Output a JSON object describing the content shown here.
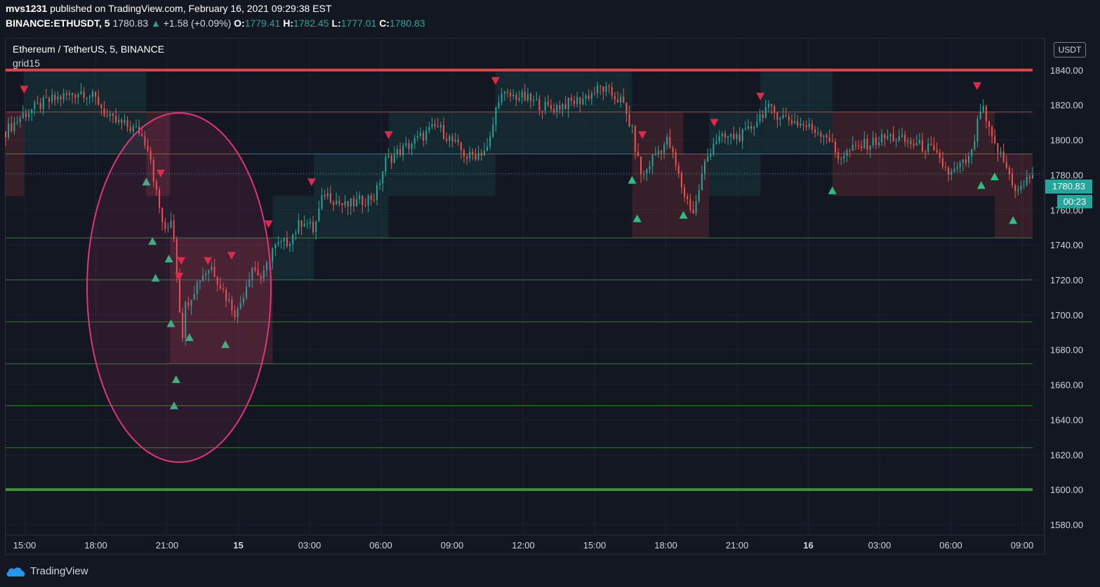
{
  "header": {
    "user": "mvs1231",
    "published_text": "published on TradingView.com, February 16, 2021 09:29:38 EST",
    "symbol": "BINANCE:ETHUSDT, 5",
    "last": "1780.83",
    "change": "+1.58 (+0.09%)",
    "o_label": "O:",
    "o": "1779.41",
    "h_label": "H:",
    "h": "1782.45",
    "l_label": "L:",
    "l": "1777.01",
    "c_label": "C:",
    "c": "1780.83"
  },
  "legend": {
    "series_title": "Ethereum / TetherUS, 5, BINANCE",
    "indicator": "grid15"
  },
  "currency": "USDT",
  "price_tag": "1780.83",
  "countdown": "00:23",
  "brand": "TradingView",
  "colors": {
    "background": "#131722",
    "up": "#26a69a",
    "down": "#ef5350",
    "buy_marker": "#2ebd85",
    "sell_marker": "#e0294a",
    "resistance_line": "#e0434b",
    "support_line": "#3f8f3f",
    "circle": "#e0357a"
  },
  "chart_data": {
    "type": "candlestick",
    "title": "Ethereum / TetherUS, 5, BINANCE",
    "y_ticks": [
      "1840.00",
      "1820.00",
      "1800.00",
      "1780.00",
      "1760.00",
      "1740.00",
      "1720.00",
      "1700.00",
      "1680.00",
      "1660.00",
      "1640.00",
      "1620.00",
      "1600.00",
      "1580.00"
    ],
    "ylim": [
      1574,
      1858
    ],
    "x_ticks": [
      "15:00",
      "18:00",
      "21:00",
      "15",
      "03:00",
      "06:00",
      "09:00",
      "12:00",
      "15:00",
      "18:00",
      "21:00",
      "16",
      "03:00",
      "06:00",
      "09:00"
    ],
    "grid_levels": [
      {
        "price": 1840,
        "kind": "resistance",
        "bold": true
      },
      {
        "price": 1816,
        "kind": "resistance"
      },
      {
        "price": 1792,
        "kind": "resistance"
      },
      {
        "price": 1744,
        "kind": "support"
      },
      {
        "price": 1720,
        "kind": "support"
      },
      {
        "price": 1696,
        "kind": "support"
      },
      {
        "price": 1672,
        "kind": "support"
      },
      {
        "price": 1648,
        "kind": "support"
      },
      {
        "price": 1624,
        "kind": "support"
      },
      {
        "price": 1600,
        "kind": "support",
        "bold": true
      }
    ],
    "last_price": 1780.83,
    "price_path": [
      [
        0,
        1805
      ],
      [
        0.018,
        1815
      ],
      [
        0.04,
        1822
      ],
      [
        0.075,
        1828
      ],
      [
        0.09,
        1822
      ],
      [
        0.1,
        1812
      ],
      [
        0.13,
        1805
      ],
      [
        0.14,
        1795
      ],
      [
        0.145,
        1775
      ],
      [
        0.15,
        1760
      ],
      [
        0.156,
        1745
      ],
      [
        0.162,
        1758
      ],
      [
        0.17,
        1700
      ],
      [
        0.165,
        1680
      ],
      [
        0.168,
        1665
      ],
      [
        0.175,
        1705
      ],
      [
        0.19,
        1722
      ],
      [
        0.2,
        1728
      ],
      [
        0.215,
        1710
      ],
      [
        0.225,
        1700
      ],
      [
        0.24,
        1728
      ],
      [
        0.25,
        1720
      ],
      [
        0.26,
        1738
      ],
      [
        0.275,
        1742
      ],
      [
        0.29,
        1755
      ],
      [
        0.3,
        1748
      ],
      [
        0.31,
        1770
      ],
      [
        0.33,
        1762
      ],
      [
        0.36,
        1768
      ],
      [
        0.37,
        1788
      ],
      [
        0.4,
        1800
      ],
      [
        0.42,
        1808
      ],
      [
        0.45,
        1790
      ],
      [
        0.47,
        1795
      ],
      [
        0.48,
        1825
      ],
      [
        0.5,
        1825
      ],
      [
        0.53,
        1818
      ],
      [
        0.56,
        1823
      ],
      [
        0.58,
        1830
      ],
      [
        0.6,
        1822
      ],
      [
        0.61,
        1805
      ],
      [
        0.615,
        1790
      ],
      [
        0.62,
        1778
      ],
      [
        0.63,
        1790
      ],
      [
        0.645,
        1800
      ],
      [
        0.66,
        1770
      ],
      [
        0.67,
        1758
      ],
      [
        0.68,
        1785
      ],
      [
        0.69,
        1800
      ],
      [
        0.72,
        1803
      ],
      [
        0.74,
        1818
      ],
      [
        0.77,
        1810
      ],
      [
        0.8,
        1803
      ],
      [
        0.81,
        1790
      ],
      [
        0.83,
        1796
      ],
      [
        0.86,
        1802
      ],
      [
        0.9,
        1795
      ],
      [
        0.92,
        1780
      ],
      [
        0.94,
        1790
      ],
      [
        0.95,
        1820
      ],
      [
        0.96,
        1800
      ],
      [
        0.97,
        1790
      ],
      [
        0.985,
        1770
      ],
      [
        1.0,
        1781
      ]
    ],
    "buy_signals": [
      {
        "t": 0.137,
        "p": 1776
      },
      {
        "t": 0.143,
        "p": 1742
      },
      {
        "t": 0.146,
        "p": 1721
      },
      {
        "t": 0.159,
        "p": 1732
      },
      {
        "t": 0.161,
        "p": 1695
      },
      {
        "t": 0.166,
        "p": 1663
      },
      {
        "t": 0.164,
        "p": 1648
      },
      {
        "t": 0.179,
        "p": 1687
      },
      {
        "t": 0.214,
        "p": 1683
      },
      {
        "t": 0.61,
        "p": 1777
      },
      {
        "t": 0.615,
        "p": 1755
      },
      {
        "t": 0.66,
        "p": 1757
      },
      {
        "t": 0.805,
        "p": 1771
      },
      {
        "t": 0.95,
        "p": 1774
      },
      {
        "t": 0.963,
        "p": 1779
      },
      {
        "t": 0.981,
        "p": 1754
      }
    ],
    "sell_signals": [
      {
        "t": 0.018,
        "p": 1829
      },
      {
        "t": 0.151,
        "p": 1781
      },
      {
        "t": 0.171,
        "p": 1731
      },
      {
        "t": 0.169,
        "p": 1722
      },
      {
        "t": 0.197,
        "p": 1731
      },
      {
        "t": 0.22,
        "p": 1734
      },
      {
        "t": 0.256,
        "p": 1752
      },
      {
        "t": 0.298,
        "p": 1776
      },
      {
        "t": 0.373,
        "p": 1803
      },
      {
        "t": 0.477,
        "p": 1834
      },
      {
        "t": 0.62,
        "p": 1803
      },
      {
        "t": 0.69,
        "p": 1810
      },
      {
        "t": 0.735,
        "p": 1825
      },
      {
        "t": 0.946,
        "p": 1831
      }
    ],
    "zones": [
      {
        "t0": 0.0,
        "t1": 0.018,
        "top": 1816,
        "bot": 1768,
        "kind": "down"
      },
      {
        "t0": 0.018,
        "t1": 0.137,
        "top": 1840,
        "bot": 1792,
        "kind": "up"
      },
      {
        "t0": 0.137,
        "t1": 0.16,
        "top": 1816,
        "bot": 1768,
        "kind": "down"
      },
      {
        "t0": 0.16,
        "t1": 0.2,
        "top": 1744,
        "bot": 1672,
        "kind": "down"
      },
      {
        "t0": 0.2,
        "t1": 0.26,
        "top": 1744,
        "bot": 1672,
        "kind": "down"
      },
      {
        "t0": 0.26,
        "t1": 0.3,
        "top": 1768,
        "bot": 1720,
        "kind": "up"
      },
      {
        "t0": 0.3,
        "t1": 0.373,
        "top": 1792,
        "bot": 1744,
        "kind": "up"
      },
      {
        "t0": 0.373,
        "t1": 0.477,
        "top": 1816,
        "bot": 1768,
        "kind": "up"
      },
      {
        "t0": 0.477,
        "t1": 0.61,
        "top": 1840,
        "bot": 1792,
        "kind": "up"
      },
      {
        "t0": 0.61,
        "t1": 0.66,
        "top": 1816,
        "bot": 1744,
        "kind": "down"
      },
      {
        "t0": 0.66,
        "t1": 0.685,
        "top": 1792,
        "bot": 1744,
        "kind": "down"
      },
      {
        "t0": 0.685,
        "t1": 0.735,
        "top": 1816,
        "bot": 1768,
        "kind": "up"
      },
      {
        "t0": 0.735,
        "t1": 0.805,
        "top": 1840,
        "bot": 1792,
        "kind": "up"
      },
      {
        "t0": 0.805,
        "t1": 0.963,
        "top": 1816,
        "bot": 1768,
        "kind": "down"
      },
      {
        "t0": 0.963,
        "t1": 1.0,
        "top": 1792,
        "bot": 1744,
        "kind": "down"
      }
    ]
  }
}
